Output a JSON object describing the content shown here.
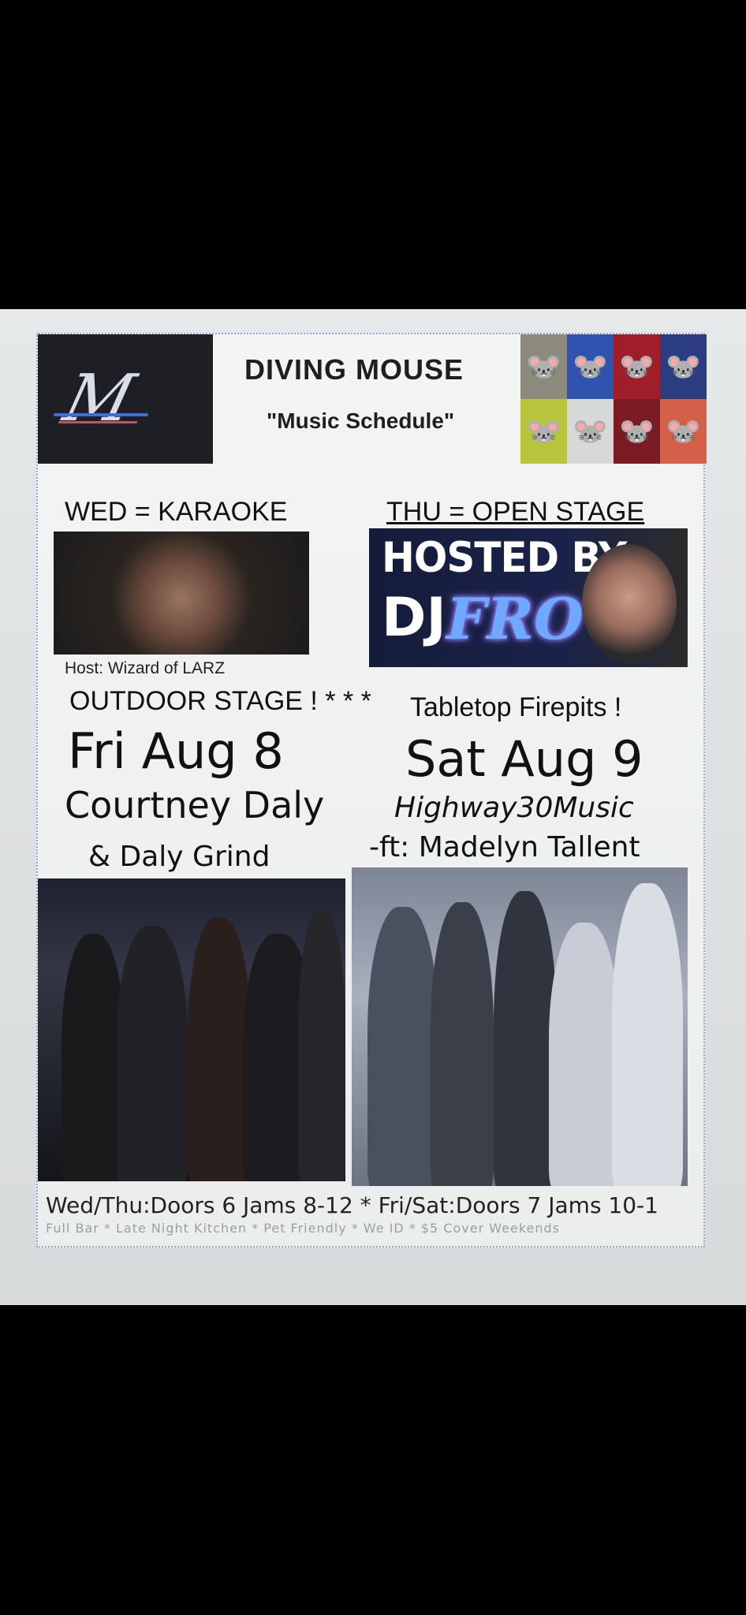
{
  "header": {
    "title": "DIVING  MOUSE",
    "subtitle": "\"Music Schedule\"",
    "logo_text": "M"
  },
  "wednesday": {
    "label": "WED = KARAOKE",
    "host": "Host:  Wizard of LARZ"
  },
  "thursday": {
    "label": "THU = OPEN  STAGE",
    "banner_hosted": "HOSTED BY",
    "banner_dj": "DJ",
    "banner_name": "FRO"
  },
  "outdoor": {
    "left": "OUTDOOR STAGE ! * * *",
    "right": "Tabletop Firepits !"
  },
  "friday": {
    "date": "Fri Aug 8",
    "artist": "Courtney Daly",
    "band": "& Daly Grind"
  },
  "saturday": {
    "date": "Sat Aug 9",
    "artist": "Highway30Music",
    "feature": "-ft: Madelyn Tallent"
  },
  "footer": {
    "hours": "Wed/Thu:Doors 6 Jams 8-12 * Fri/Sat:Doors 7 Jams 10-1",
    "details": "Full Bar * Late Night Kitchen * Pet Friendly * We ID * $5 Cover Weekends"
  },
  "colors": {
    "paper": "#eceeee",
    "dark_box": "#1d1f24",
    "neon": "#6fa8ff"
  }
}
